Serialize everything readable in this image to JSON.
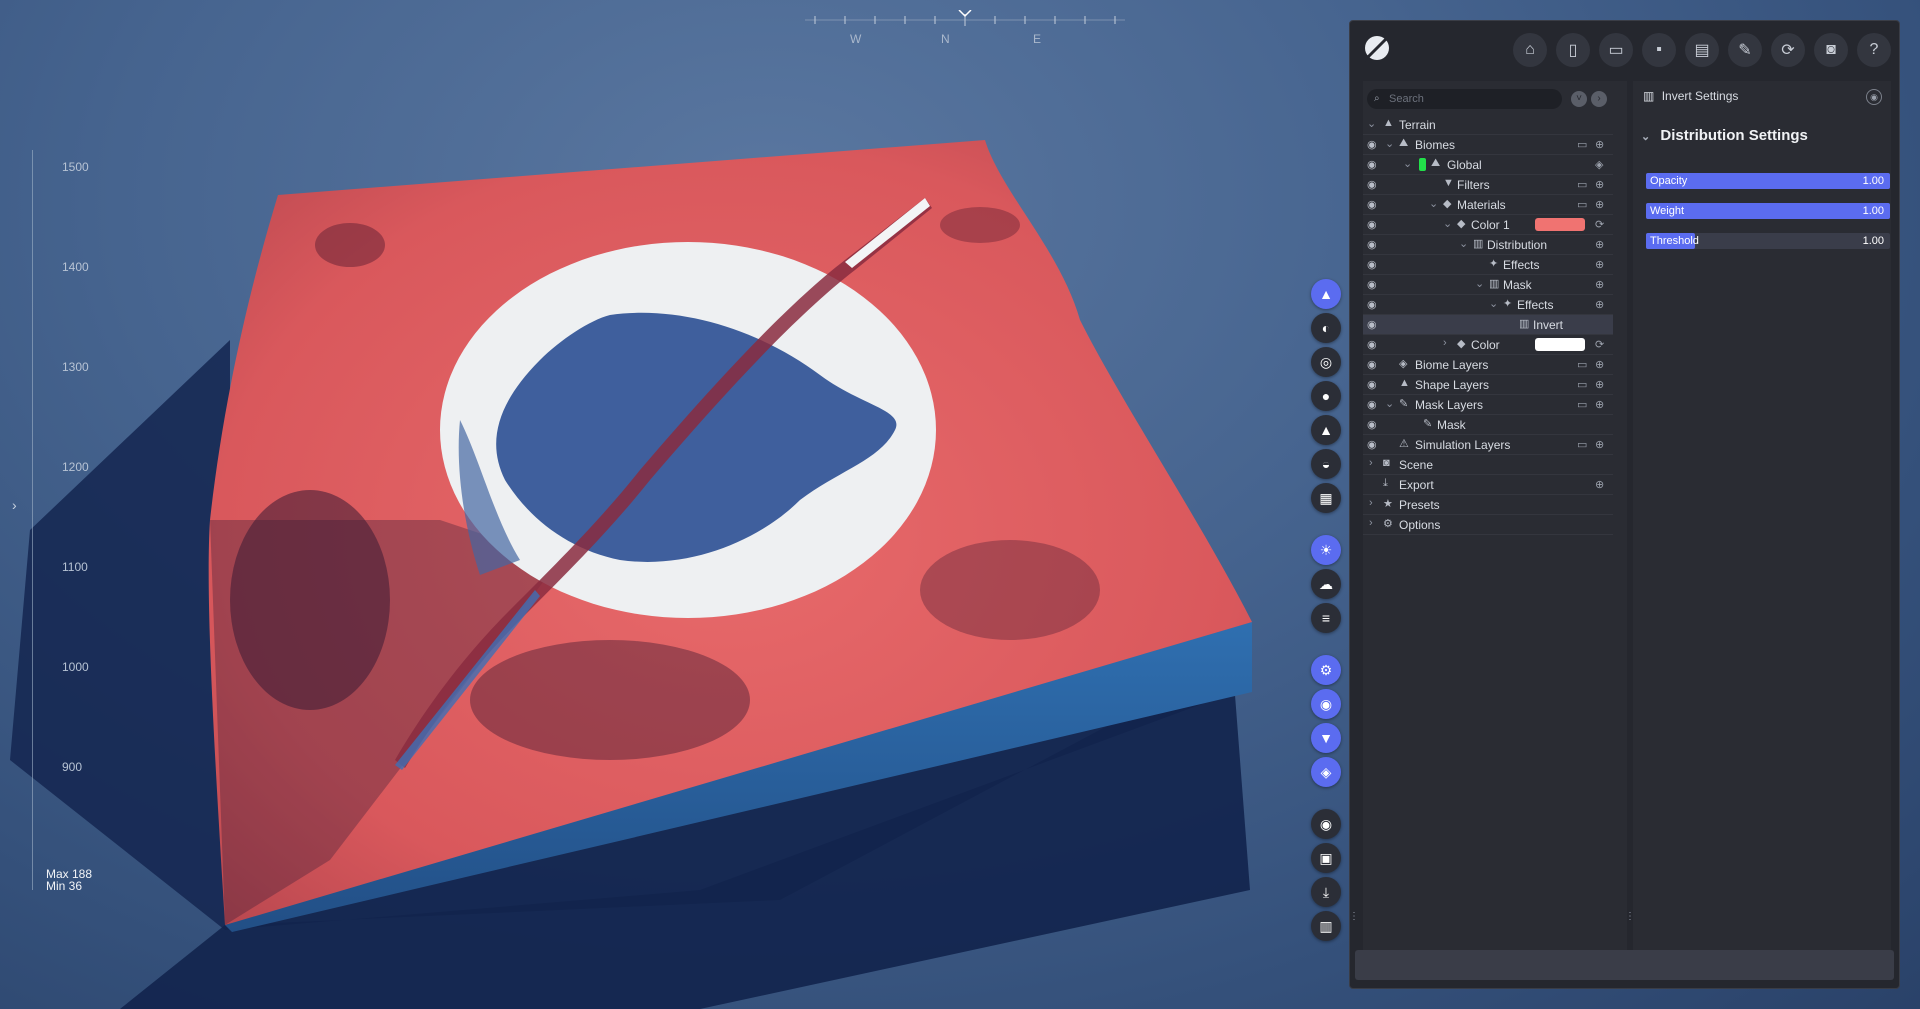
{
  "compass": {
    "west": "W",
    "north": "N",
    "east": "E"
  },
  "ruler": {
    "ticks": [
      "1500",
      "1400",
      "1300",
      "1200",
      "1100",
      "1000",
      "900"
    ],
    "max_label": "Max 188",
    "min_label": "Min 36"
  },
  "colors": {
    "accent": "#5b6cf0",
    "terrain_red": "#e15b5d",
    "snow": "#eef0f2",
    "water_blue": "#3c5d9b",
    "global_green": "#22e04a",
    "color1_swatch": "#f07371",
    "color_swatch": "#ffffff"
  },
  "vertical_toolbar": {
    "icons": [
      "terrain-icon",
      "globe-icon",
      "target-icon",
      "drop-icon",
      "mountain-icon",
      "sunset-icon",
      "grid-icon",
      "sun-icon",
      "clouds-icon",
      "fog-icon",
      "settings-icon",
      "eye-icon",
      "filter-icon",
      "layers-icon",
      "disc-icon",
      "image-icon",
      "download-icon",
      "chart-icon"
    ]
  },
  "toolbar": {
    "icons": [
      "home-icon",
      "new-file-icon",
      "open-folder-icon",
      "save-icon",
      "save-settings-icon",
      "save-as-icon",
      "refresh-icon",
      "camera-icon",
      "help-icon"
    ]
  },
  "tree": {
    "search_placeholder": "Search",
    "rows": [
      {
        "label": "Terrain"
      },
      {
        "label": "Biomes"
      },
      {
        "label": "Global"
      },
      {
        "label": "Filters"
      },
      {
        "label": "Materials"
      },
      {
        "label": "Color 1"
      },
      {
        "label": "Distribution"
      },
      {
        "label": "Effects"
      },
      {
        "label": "Mask"
      },
      {
        "label": "Effects"
      },
      {
        "label": "Invert"
      },
      {
        "label": "Color"
      },
      {
        "label": "Biome Layers"
      },
      {
        "label": "Shape Layers"
      },
      {
        "label": "Mask Layers"
      },
      {
        "label": "Mask"
      },
      {
        "label": "Simulation Layers"
      },
      {
        "label": "Scene"
      },
      {
        "label": "Export"
      },
      {
        "label": "Presets"
      },
      {
        "label": "Options"
      }
    ]
  },
  "properties": {
    "header": "Invert Settings",
    "section": "Distribution Settings",
    "sliders": [
      {
        "label": "Opacity",
        "value": "1.00",
        "fill": 1.0
      },
      {
        "label": "Weight",
        "value": "1.00",
        "fill": 1.0
      },
      {
        "label": "Threshold",
        "value": "1.00",
        "fill": 0.2
      }
    ]
  }
}
